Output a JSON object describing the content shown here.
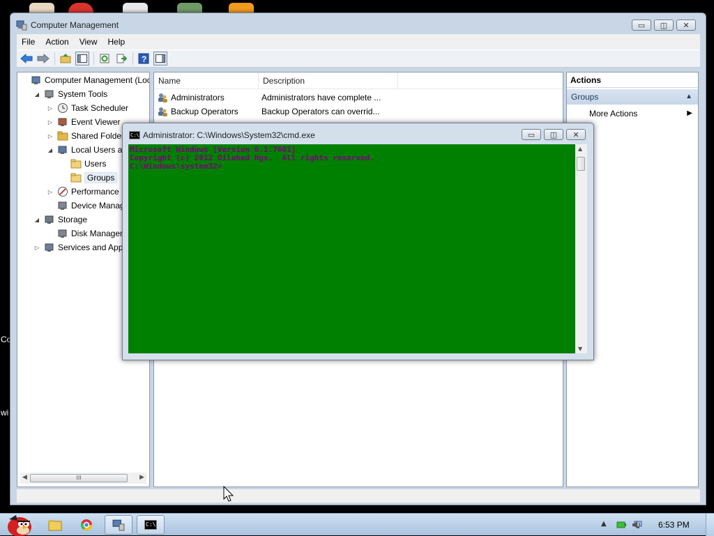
{
  "desktop": {
    "partial_labels": [
      "Co",
      "wi"
    ]
  },
  "mmc": {
    "title": "Computer Management",
    "caption_buttons": {
      "minimize": "▭",
      "restore": "◫",
      "close": "✕"
    },
    "menu": [
      "File",
      "Action",
      "View",
      "Help"
    ],
    "toolbar_icons": [
      "back-arrow-icon",
      "forward-arrow-icon",
      "up-folder-icon",
      "show-hide-tree-icon",
      "refresh-icon",
      "export-list-icon",
      "help-icon",
      "show-hide-action-pane-icon"
    ],
    "tree": {
      "items": [
        {
          "label": "Computer Management (Loca",
          "level": 0,
          "icon": "computer-management-icon",
          "expander": ""
        },
        {
          "label": "System Tools",
          "level": 1,
          "icon": "system-tools-icon",
          "expander": "◢"
        },
        {
          "label": "Task Scheduler",
          "level": 2,
          "icon": "clock-icon",
          "expander": "▷"
        },
        {
          "label": "Event Viewer",
          "level": 2,
          "icon": "event-viewer-icon",
          "expander": "▷"
        },
        {
          "label": "Shared Folders",
          "level": 2,
          "icon": "shared-folder-icon",
          "expander": "▷"
        },
        {
          "label": "Local Users and",
          "level": 2,
          "icon": "local-users-icon",
          "expander": "◢"
        },
        {
          "label": "Users",
          "level": 3,
          "icon": "folder-icon",
          "expander": ""
        },
        {
          "label": "Groups",
          "level": 3,
          "icon": "folder-icon",
          "expander": "",
          "selected": true
        },
        {
          "label": "Performance",
          "level": 2,
          "icon": "performance-icon",
          "expander": "▷"
        },
        {
          "label": "Device Manager",
          "level": 2,
          "icon": "device-manager-icon",
          "expander": ""
        },
        {
          "label": "Storage",
          "level": 1,
          "icon": "storage-icon",
          "expander": "◢"
        },
        {
          "label": "Disk Manageme",
          "level": 2,
          "icon": "disk-management-icon",
          "expander": ""
        },
        {
          "label": "Services and Applic",
          "level": 1,
          "icon": "services-icon",
          "expander": "▷"
        }
      ],
      "scroll_thumb_label": "III"
    },
    "list": {
      "columns": [
        "Name",
        "Description"
      ],
      "rows": [
        {
          "name": "Administrators",
          "description": "Administrators have complete ..."
        },
        {
          "name": "Backup Operators",
          "description": "Backup Operators can overrid..."
        }
      ]
    },
    "actions": {
      "header": "Actions",
      "section": "Groups",
      "section_arrow": "▲",
      "item": "More Actions",
      "item_arrow": "▶"
    }
  },
  "cmd": {
    "title": "Administrator: C:\\Windows\\System32\\cmd.exe",
    "icon_text": "C:\\",
    "lines": [
      "Microsoft Windows [Version 6.1.7601]",
      "Copyright (c) 2012 Oilahed Hgs.  All rights reserved.",
      "",
      "C:\\Windows\\system32>"
    ],
    "colors": {
      "background": "#008000",
      "foreground": "#800080"
    }
  },
  "taskbar": {
    "clock": "6:53 PM",
    "buttons": [
      "start-orb-icon",
      "explorer-icon",
      "chrome-icon",
      "computer-management-icon",
      "cmd-icon"
    ]
  }
}
